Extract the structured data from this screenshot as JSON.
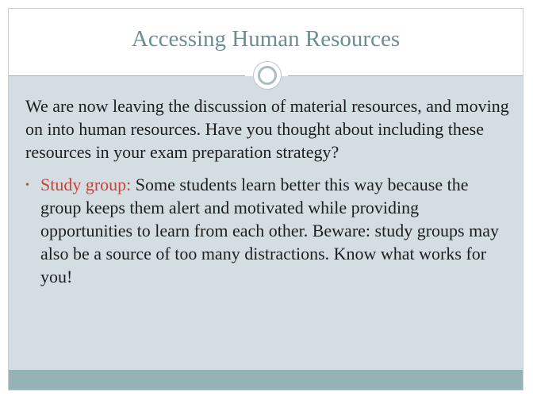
{
  "slide": {
    "title": "Accessing Human Resources",
    "intro": "We are now leaving the discussion of material resources, and moving on into human resources.  Have you thought about including these resources in your exam preparation strategy?",
    "bullets": [
      {
        "marker": "•",
        "term": "Study group:",
        "text": "Some students learn better this way because the group keeps them alert and motivated while providing opportunities to learn from each other.  Beware: study groups may also be a source of too many distractions.  Know what works for you!"
      }
    ]
  },
  "colors": {
    "title": "#6a8f92",
    "content_background": "#d3dde2",
    "bottom_band": "#95b3b5",
    "accent": "#c7443a",
    "body_text": "#1e1e1e"
  }
}
